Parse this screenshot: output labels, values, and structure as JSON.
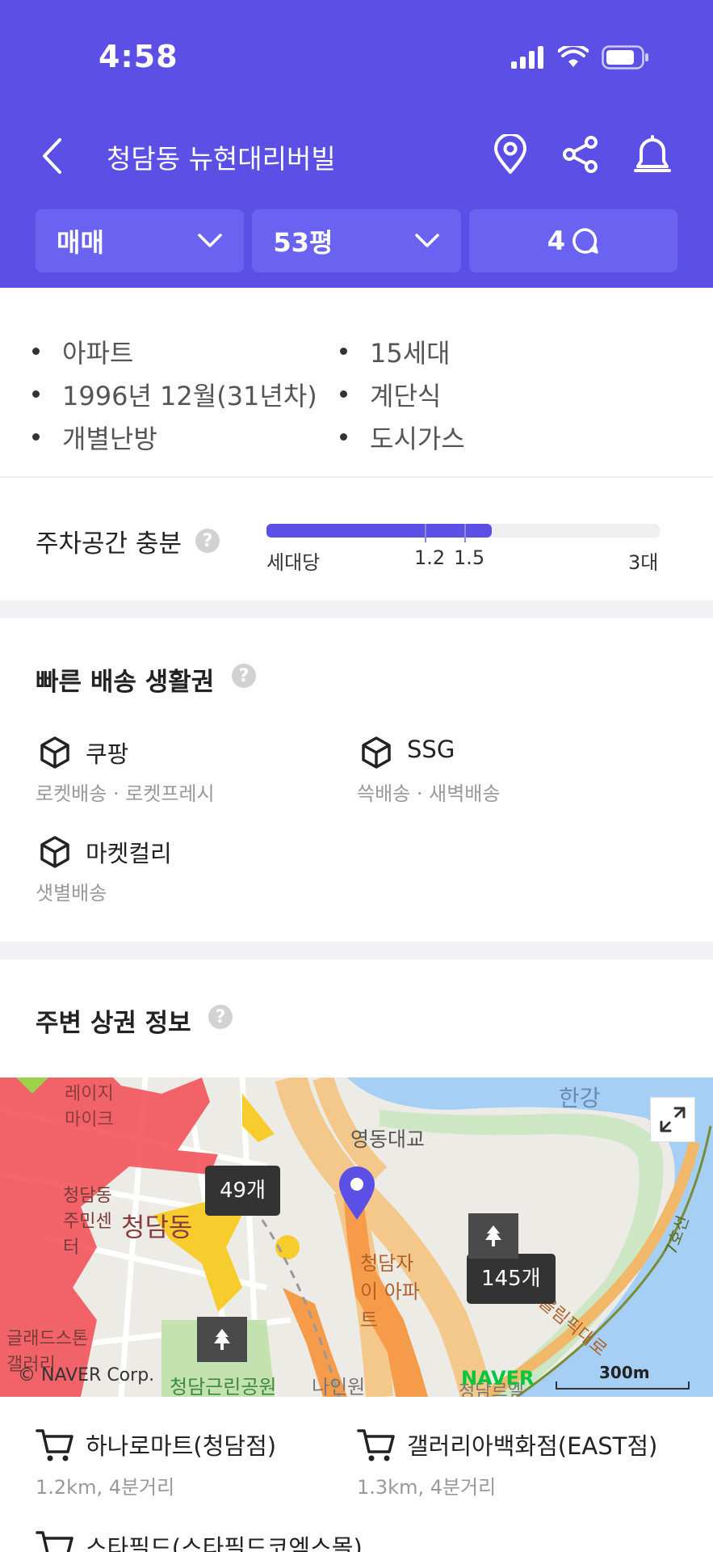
{
  "status": {
    "time": "4:58"
  },
  "header": {
    "title": "청담동 뉴현대리버빌",
    "filters": [
      {
        "label": "매매"
      },
      {
        "label": "53평"
      },
      {
        "label": "4"
      }
    ]
  },
  "info": {
    "left": [
      "아파트",
      "1996년 12월(31년차)",
      "개별난방"
    ],
    "right": [
      "15세대",
      "계단식",
      "도시가스"
    ]
  },
  "parking": {
    "label": "주차공간 충분",
    "unit_label": "세대당",
    "marks": [
      "1.2",
      "1.5"
    ],
    "max_label": "3대",
    "value": 1.72,
    "max": 3
  },
  "delivery": {
    "title": "빠른 배송 생활권",
    "items": [
      {
        "name": "쿠팡",
        "sub": "로켓배송 · 로켓프레시"
      },
      {
        "name": "SSG",
        "sub": "쓱배송 · 새벽배송"
      },
      {
        "name": "마켓컬리",
        "sub": "샛별배송"
      }
    ]
  },
  "commerce": {
    "title": "주변 상권 정보",
    "map": {
      "counts": [
        "49개",
        "145개"
      ],
      "labels": [
        "한강",
        "영동대교",
        "청담동 주민센터",
        "청담동",
        "청담자이 아파트",
        "글래드스톤 갤러리",
        "청담근린공원",
        "나인원",
        "청담르엘",
        "7호선",
        "올림픽대로",
        "레이지 마이크"
      ],
      "copyright": "© NAVER Corp.",
      "brand": "NAVER",
      "scale": "300m"
    },
    "marts": [
      {
        "name": "하나로마트(청담점)",
        "sub": "1.2km, 4분거리"
      },
      {
        "name": "갤러리아백화점(EAST점)",
        "sub": "1.3km, 4분거리"
      },
      {
        "name": "스타필드(스타필드코엑스몰)",
        "sub": ""
      }
    ]
  },
  "colors": {
    "brand": "#5b4fe6",
    "filter_bg": "#6a63f2"
  }
}
